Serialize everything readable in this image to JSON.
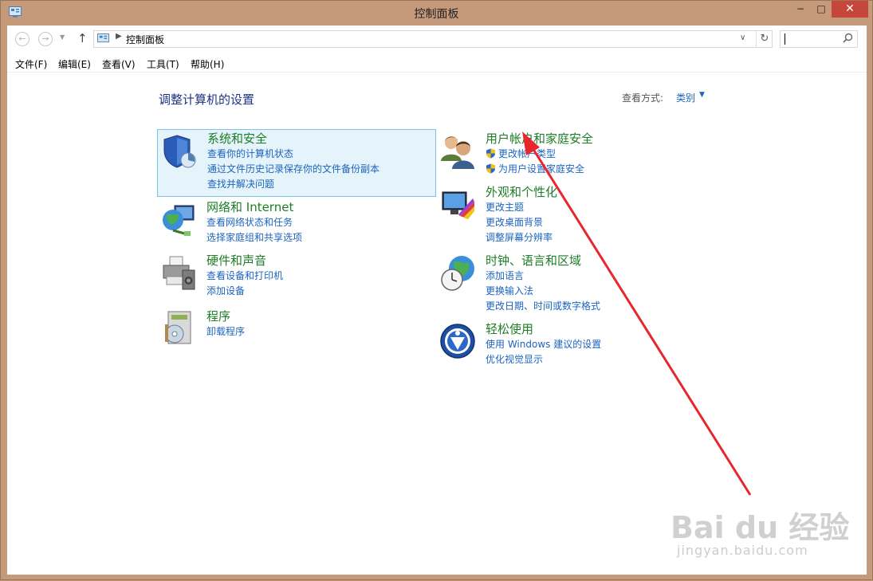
{
  "window": {
    "title": "控制面板",
    "minimize": "−",
    "maximize": "□",
    "close": "✕"
  },
  "address": {
    "breadcrumb": "控制面板",
    "search_placeholder": ""
  },
  "menu": [
    "文件(F)",
    "编辑(E)",
    "查看(V)",
    "工具(T)",
    "帮助(H)"
  ],
  "content": {
    "heading": "调整计算机的设置",
    "view_by_label": "查看方式:",
    "view_by_value": "类别"
  },
  "categories": [
    {
      "title": "系统和安全",
      "icon": "shield-icon",
      "links": [
        "查看你的计算机状态",
        "通过文件历史记录保存你的文件备份副本",
        "查找并解决问题"
      ]
    },
    {
      "title": "网络和 Internet",
      "icon": "network-icon",
      "links": [
        "查看网络状态和任务",
        "选择家庭组和共享选项"
      ]
    },
    {
      "title": "硬件和声音",
      "icon": "printer-icon",
      "links": [
        "查看设备和打印机",
        "添加设备"
      ]
    },
    {
      "title": "程序",
      "icon": "programs-icon",
      "links": [
        "卸载程序"
      ]
    },
    {
      "title": "用户帐户和家庭安全",
      "icon": "users-icon",
      "links": [
        "更改帐户类型",
        "为用户设置家庭安全"
      ]
    },
    {
      "title": "外观和个性化",
      "icon": "display-icon",
      "links": [
        "更改主题",
        "更改桌面背景",
        "调整屏幕分辨率"
      ]
    },
    {
      "title": "时钟、语言和区域",
      "icon": "clock-globe-icon",
      "links": [
        "添加语言",
        "更换输入法",
        "更改日期、时间或数字格式"
      ]
    },
    {
      "title": "轻松使用",
      "icon": "ease-of-access-icon",
      "links": [
        "使用 Windows 建议的设置",
        "优化视觉显示"
      ]
    }
  ],
  "watermark": {
    "text": "Bai du 经验",
    "url": "jingyan.baidu.com"
  },
  "colors": {
    "frame": "#c49a7b",
    "link": "#1c64bf",
    "category_title": "#1e7d26",
    "heading": "#1e3287",
    "annotation_arrow": "#e8262e"
  }
}
